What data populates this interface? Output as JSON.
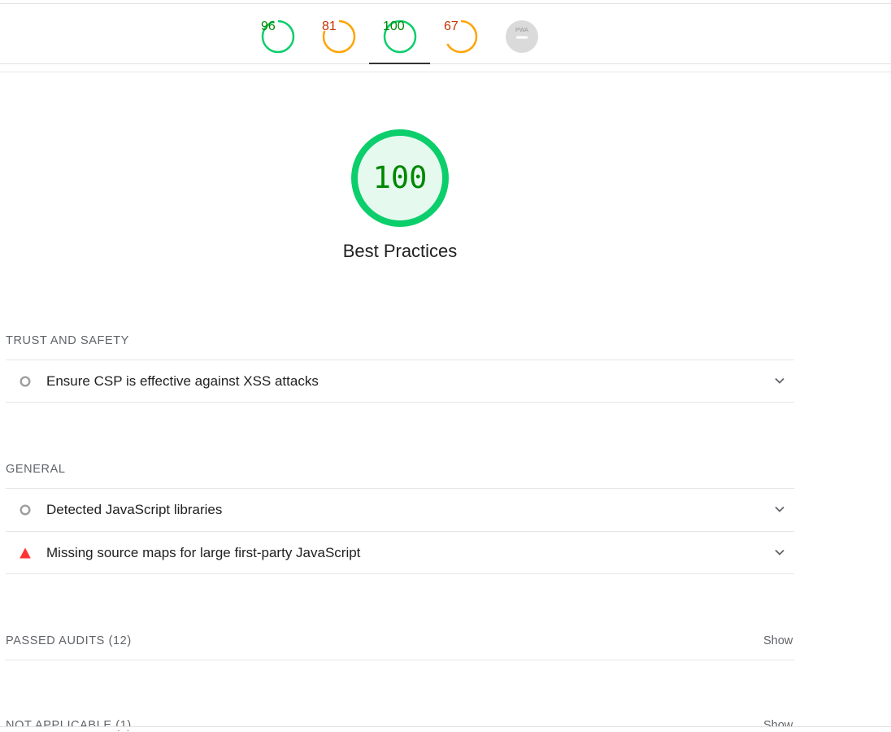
{
  "header": {
    "scores": [
      {
        "label": "96",
        "value": 96,
        "color": "#0cce6b",
        "text_color": "#008800",
        "active": false
      },
      {
        "label": "81",
        "value": 81,
        "color": "#ffa400",
        "text_color": "#c33300",
        "active": false
      },
      {
        "label": "100",
        "value": 100,
        "color": "#0cce6b",
        "text_color": "#008800",
        "active": true
      },
      {
        "label": "67",
        "value": 67,
        "color": "#ffa400",
        "text_color": "#c33300",
        "active": false
      },
      {
        "label": "PWA",
        "value": null,
        "color": "#cccccc",
        "text_color": "#999999",
        "active": false
      }
    ]
  },
  "main": {
    "score": "100",
    "score_value": 100,
    "score_color": "#0cce6b",
    "title": "Best Practices"
  },
  "groups": {
    "trust": {
      "title": "TRUST AND SAFETY",
      "audits": [
        {
          "label": "Ensure CSP is effective against XSS attacks",
          "icon": "informative-circle-icon"
        }
      ]
    },
    "general": {
      "title": "GENERAL",
      "audits": [
        {
          "label": "Detected JavaScript libraries",
          "icon": "informative-circle-icon"
        },
        {
          "label": "Missing source maps for large first-party JavaScript",
          "icon": "fail-triangle-icon"
        }
      ]
    },
    "passed": {
      "title": "PASSED AUDITS",
      "count": "(12)",
      "show_label": "Show"
    },
    "not_applicable": {
      "title": "NOT APPLICABLE",
      "count": "(1)",
      "show_label": "Show"
    }
  }
}
